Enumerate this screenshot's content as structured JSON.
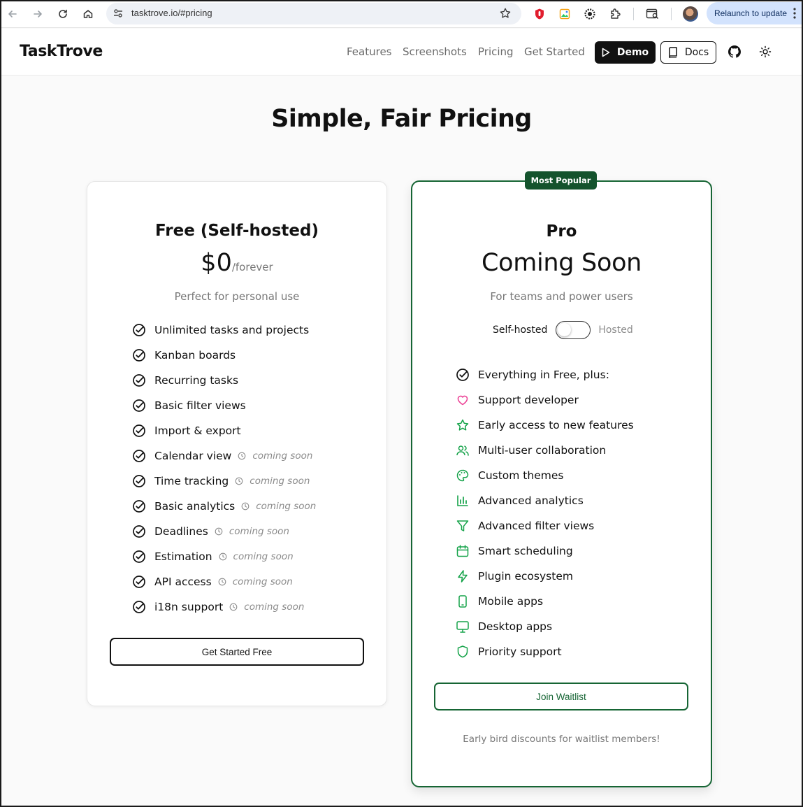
{
  "browser": {
    "url": "tasktrove.io/#pricing",
    "relaunch_label": "Relaunch to update"
  },
  "site": {
    "brand": "TaskTrove",
    "nav": [
      "Features",
      "Screenshots",
      "Pricing",
      "Get Started"
    ],
    "demo_label": "Demo",
    "docs_label": "Docs"
  },
  "pricing": {
    "headline": "Simple, Fair Pricing",
    "free": {
      "name": "Free (Self-hosted)",
      "price": "$0",
      "period": "/forever",
      "description": "Perfect for personal use",
      "features": [
        {
          "label": "Unlimited tasks and projects",
          "soon": ""
        },
        {
          "label": "Kanban boards",
          "soon": ""
        },
        {
          "label": "Recurring tasks",
          "soon": ""
        },
        {
          "label": "Basic filter views",
          "soon": ""
        },
        {
          "label": "Import & export",
          "soon": ""
        },
        {
          "label": "Calendar view",
          "soon": "coming soon"
        },
        {
          "label": "Time tracking",
          "soon": "coming soon"
        },
        {
          "label": "Basic analytics",
          "soon": "coming soon"
        },
        {
          "label": "Deadlines",
          "soon": "coming soon"
        },
        {
          "label": "Estimation",
          "soon": "coming soon"
        },
        {
          "label": "API access",
          "soon": "coming soon"
        },
        {
          "label": "i18n support",
          "soon": "coming soon"
        }
      ],
      "cta": "Get Started Free"
    },
    "pro": {
      "badge": "Most Popular",
      "name": "Pro",
      "status": "Coming Soon",
      "description": "For teams and power users",
      "toggle_left": "Self-hosted",
      "toggle_right": "Hosted",
      "features": [
        {
          "label": "Everything in Free, plus:",
          "icon": "check-circle-icon",
          "color": "#111111"
        },
        {
          "label": "Support developer",
          "icon": "heart-icon",
          "color": "#ec4899"
        },
        {
          "label": "Early access to new features",
          "icon": "star-icon",
          "color": "#16a34a"
        },
        {
          "label": "Multi-user collaboration",
          "icon": "users-icon",
          "color": "#16a34a"
        },
        {
          "label": "Custom themes",
          "icon": "palette-icon",
          "color": "#16a34a"
        },
        {
          "label": "Advanced analytics",
          "icon": "bar-chart-icon",
          "color": "#16a34a"
        },
        {
          "label": "Advanced filter views",
          "icon": "filter-icon",
          "color": "#16a34a"
        },
        {
          "label": "Smart scheduling",
          "icon": "calendar-icon",
          "color": "#16a34a"
        },
        {
          "label": "Plugin ecosystem",
          "icon": "zap-icon",
          "color": "#16a34a"
        },
        {
          "label": "Mobile apps",
          "icon": "smartphone-icon",
          "color": "#16a34a"
        },
        {
          "label": "Desktop apps",
          "icon": "monitor-icon",
          "color": "#16a34a"
        },
        {
          "label": "Priority support",
          "icon": "shield-icon",
          "color": "#16a34a"
        }
      ],
      "cta": "Join Waitlist",
      "footnote": "Early bird discounts for waitlist members!"
    }
  },
  "colors": {
    "accent_green": "#166534",
    "icon_green": "#16a34a",
    "heart_pink": "#ec4899"
  }
}
